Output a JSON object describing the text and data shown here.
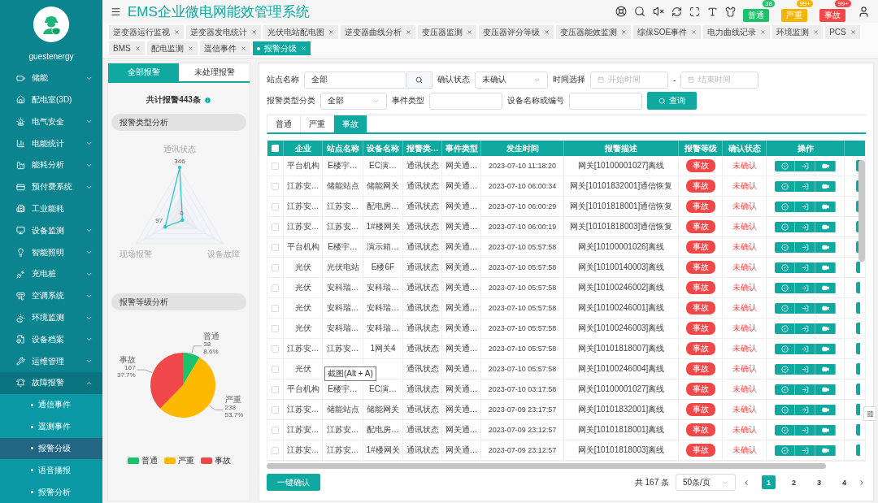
{
  "sidebar": {
    "user": "guestenergy",
    "items": [
      {
        "label": "储能",
        "expanded": false
      },
      {
        "label": "配电室(3D)"
      },
      {
        "label": "电气安全",
        "expanded": false
      },
      {
        "label": "电能统计",
        "expanded": false
      },
      {
        "label": "能耗分析",
        "expanded": false
      },
      {
        "label": "预付费系统",
        "expanded": false
      },
      {
        "label": "工业能耗"
      },
      {
        "label": "设备监测",
        "expanded": false
      },
      {
        "label": "智能照明",
        "expanded": false
      },
      {
        "label": "充电桩",
        "expanded": false
      },
      {
        "label": "空调系统",
        "expanded": false
      },
      {
        "label": "环境监测",
        "expanded": false
      },
      {
        "label": "设备档案",
        "expanded": false
      },
      {
        "label": "运维管理",
        "expanded": false
      },
      {
        "label": "故障报警",
        "expanded": true,
        "children": [
          {
            "label": "通信事件",
            "selected": false
          },
          {
            "label": "遥测事件",
            "selected": false
          },
          {
            "label": "报警分级",
            "selected": true
          },
          {
            "label": "语音播报",
            "selected": false
          },
          {
            "label": "报警分析",
            "selected": false
          }
        ]
      }
    ]
  },
  "header": {
    "title": "EMS企业微电网能效管理系统",
    "alerts": [
      {
        "label": "普通",
        "count": "38",
        "color": "#19c36a"
      },
      {
        "label": "严重",
        "count": "99+",
        "color": "#f5b400"
      },
      {
        "label": "事故",
        "count": "99+",
        "color": "#f04848"
      }
    ]
  },
  "page_tabs": [
    {
      "label": "逆变器运行监视",
      "selected": false
    },
    {
      "label": "逆变器发电统计",
      "selected": false
    },
    {
      "label": "光伏电站配电图",
      "selected": false
    },
    {
      "label": "逆变器曲线分析",
      "selected": false
    },
    {
      "label": "变压器监测",
      "selected": false
    },
    {
      "label": "变压器评分等级",
      "selected": false
    },
    {
      "label": "变压器能效监测",
      "selected": false
    },
    {
      "label": "综保SOE事件",
      "selected": false
    },
    {
      "label": "电力曲线记录",
      "selected": false
    },
    {
      "label": "环境监测",
      "selected": false
    },
    {
      "label": "PCS",
      "selected": false
    },
    {
      "label": "BMS",
      "selected": false
    },
    {
      "label": "配电监测",
      "selected": false
    },
    {
      "label": "遥信事件",
      "selected": false
    },
    {
      "label": "报警分级",
      "selected": true
    }
  ],
  "summary": {
    "tabs": [
      {
        "label": "全部报警",
        "selected": true
      },
      {
        "label": "未处理报警",
        "selected": false
      }
    ],
    "total": "共计报警443条",
    "type_section": "报警类型分析",
    "type_chart": {
      "axes": [
        {
          "label": "通讯状态",
          "value": "346"
        },
        {
          "label": "现场报警",
          "value": "97"
        },
        {
          "label": "设备故障",
          "value": "0"
        }
      ]
    },
    "level_section": "报警等级分析",
    "level_chart": {
      "chart_data": {
        "type": "pie",
        "categories": [
          "普通",
          "严重",
          "事故"
        ],
        "series": [
          {
            "values": [
              38,
              238,
              167
            ]
          }
        ],
        "data_labels": true
      },
      "slice_labels": [
        {
          "value": "38",
          "percent": "8.6%"
        },
        {
          "value": "238",
          "percent": "53.7%"
        },
        {
          "value": "167",
          "percent": "37.7%"
        }
      ],
      "legend": [
        {
          "label": "普通",
          "color": "#19c36a"
        },
        {
          "label": "严重",
          "color": "#fdb800"
        },
        {
          "label": "事故",
          "color": "#f04848"
        }
      ]
    }
  },
  "filters": {
    "station": {
      "label": "站点名称",
      "value": "全部"
    },
    "confirm": {
      "label": "确认状态",
      "value": "未确认"
    },
    "time": {
      "label": "时间选择",
      "start_placeholder": "开始时间",
      "separator": "-",
      "end_placeholder": "结束时间"
    },
    "category": {
      "label": "报警类型分类",
      "value": "全部"
    },
    "event_type": {
      "label": "事件类型"
    },
    "device": {
      "label": "设备名称或编号"
    },
    "query_button": "查询"
  },
  "level_tabs": [
    {
      "label": "普通",
      "selected": false
    },
    {
      "label": "严重",
      "selected": false
    },
    {
      "label": "事故",
      "selected": true
    }
  ],
  "table": {
    "all_checked": false,
    "columns": [
      "企业",
      "站点名称",
      "设备名称",
      "报警类…",
      "事件类型",
      "发生时间",
      "报警描述",
      "报警等级",
      "确认状态",
      "操作"
    ],
    "rows": [
      {
        "checked": false,
        "company": "平台机构",
        "station": "E楼宇…",
        "device": "EC演…",
        "alarm_type": "通讯状态",
        "event_type": "网关通…",
        "time": "2023-07-10 11:18:20",
        "description": "网关[10100001027]离线",
        "level": "事故",
        "status": "未确认"
      },
      {
        "checked": false,
        "company": "江苏安…",
        "station": "储能站点",
        "device": "储能网关",
        "alarm_type": "通讯状态",
        "event_type": "网关通…",
        "time": "2023-07-10 06:00:34",
        "description": "网关[10101832001]通信恢复",
        "level": "事故",
        "status": "未确认"
      },
      {
        "checked": false,
        "company": "江苏安…",
        "station": "江苏安…",
        "device": "配电房…",
        "alarm_type": "通讯状态",
        "event_type": "网关通…",
        "time": "2023-07-10 06:00:29",
        "description": "网关[10101818001]通信恢复",
        "level": "事故",
        "status": "未确认"
      },
      {
        "checked": false,
        "company": "江苏安…",
        "station": "江苏安…",
        "device": "1#楼网关",
        "alarm_type": "通讯状态",
        "event_type": "网关通…",
        "time": "2023-07-10 06:00:19",
        "description": "网关[10101818003]通信恢复",
        "level": "事故",
        "status": "未确认"
      },
      {
        "checked": false,
        "company": "平台机构",
        "station": "E楼宇…",
        "device": "演示箱…",
        "alarm_type": "通讯状态",
        "event_type": "网关通…",
        "time": "2023-07-10 05:57:58",
        "description": "网关[10100001026]离线",
        "level": "事故",
        "status": "未确认"
      },
      {
        "checked": false,
        "company": "光伏",
        "station": "光伏电站",
        "device": "E楼6F",
        "alarm_type": "通讯状态",
        "event_type": "网关通…",
        "time": "2023-07-10 05:57:58",
        "description": "网关[10100140003]离线",
        "level": "事故",
        "status": "未确认"
      },
      {
        "checked": false,
        "company": "光伏",
        "station": "安科瑞…",
        "device": "安科瑞…",
        "alarm_type": "通讯状态",
        "event_type": "网关通…",
        "time": "2023-07-10 05:57:58",
        "description": "网关[10100246002]离线",
        "level": "事故",
        "status": "未确认"
      },
      {
        "checked": false,
        "company": "光伏",
        "station": "安科瑞…",
        "device": "安科瑞…",
        "alarm_type": "通讯状态",
        "event_type": "网关通…",
        "time": "2023-07-10 05:57:58",
        "description": "网关[10100246001]离线",
        "level": "事故",
        "status": "未确认"
      },
      {
        "checked": false,
        "company": "光伏",
        "station": "安科瑞…",
        "device": "安科瑞…",
        "alarm_type": "通讯状态",
        "event_type": "网关通…",
        "time": "2023-07-10 05:57:58",
        "description": "网关[10100246003]离线",
        "level": "事故",
        "status": "未确认"
      },
      {
        "checked": false,
        "company": "江苏安…",
        "station": "江苏安…",
        "device": "1网关4",
        "alarm_type": "通讯状态",
        "event_type": "网关通…",
        "time": "2023-07-10 05:57:58",
        "description": "网关[10101818007]离线",
        "level": "事故",
        "status": "未确认"
      },
      {
        "checked": false,
        "company": "光伏",
        "alarm_type": "通讯状态",
        "event_type": "网关通…",
        "time": "2023-07-10 05:57:58",
        "description": "网关[10100246004]离线",
        "level": "事故",
        "status": "未确认",
        "tooltip": "截图(Alt + A)"
      },
      {
        "checked": false,
        "company": "平台机构",
        "station": "E楼宇…",
        "device": "EC演…",
        "alarm_type": "通讯状态",
        "event_type": "网关通…",
        "time": "2023-07-10 03:17:58",
        "description": "网关[10100001027]离线",
        "level": "事故",
        "status": "未确认"
      },
      {
        "checked": false,
        "company": "江苏安…",
        "station": "储能站点",
        "device": "储能网关",
        "alarm_type": "通讯状态",
        "event_type": "网关通…",
        "time": "2023-07-09 23:17:57",
        "description": "网关[10101832001]离线",
        "level": "事故",
        "status": "未确认"
      },
      {
        "checked": false,
        "company": "江苏安…",
        "station": "江苏安…",
        "device": "配电房…",
        "alarm_type": "通讯状态",
        "event_type": "网关通…",
        "time": "2023-07-09 23:12:57",
        "description": "网关[10101818001]离线",
        "level": "事故",
        "status": "未确认"
      },
      {
        "checked": false,
        "company": "江苏安…",
        "station": "江苏安…",
        "device": "1#楼网关",
        "alarm_type": "通讯状态",
        "event_type": "网关通…",
        "time": "2023-07-09 23:12:57",
        "description": "网关[10101818003]离线",
        "level": "事故",
        "status": "未确认"
      }
    ]
  },
  "footer": {
    "confirm_all": "一键确认",
    "total": "共 167 条",
    "page_size": "50条/页",
    "pages": [
      {
        "label": "1",
        "selected": true
      },
      {
        "label": "2",
        "selected": false
      },
      {
        "label": "3",
        "selected": false
      },
      {
        "label": "4",
        "selected": false
      }
    ]
  }
}
